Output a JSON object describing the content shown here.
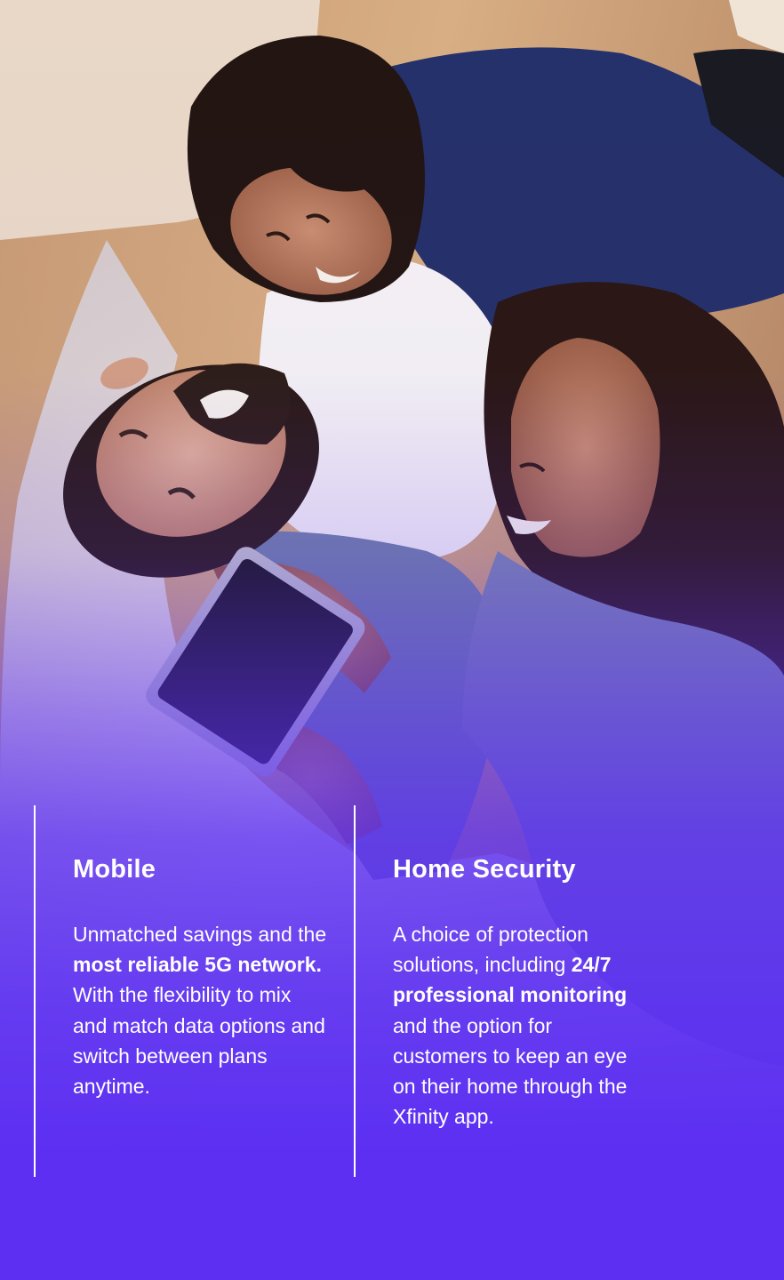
{
  "colors": {
    "brand_purple": "#5c2ff2",
    "text": "#ffffff"
  },
  "photo": {
    "icon": "family-photo"
  },
  "features": {
    "mobile": {
      "title": "Mobile",
      "text_1": "Unmatched savings and the ",
      "bold_1": "most reliable 5G network.",
      "text_2": " With the flexibility to mix and match data options and switch between plans anytime."
    },
    "security": {
      "title": "Home Security",
      "text_1": "A choice of protection solutions, including ",
      "bold_1": "24/7 professional monitoring",
      "text_2": " and the option for customers to keep an eye on their home through the Xfinity app."
    }
  }
}
